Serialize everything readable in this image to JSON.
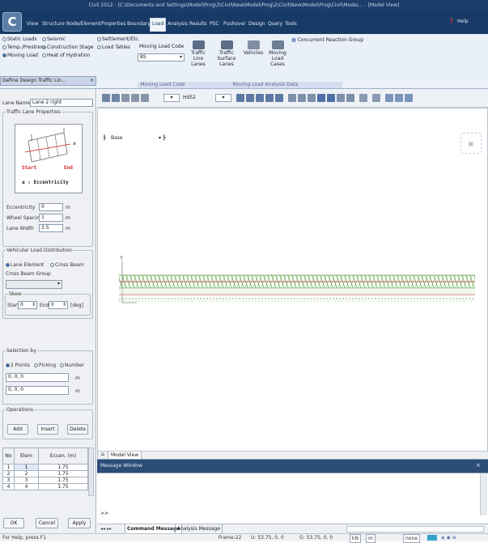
{
  "titlebar": {
    "text": "Civil 2012 - [C:\\Documents and Settings\\Model\\Prog\\2\\Civil\\New\\Model\\Prog\\2\\Civil\\New\\Model\\Prog\\Civil\\Mode\\... - [Model View]"
  },
  "menu": {
    "tabs": [
      "View",
      "Structure",
      "Node/Element",
      "Properties",
      "Boundary",
      "Load",
      "Analysis",
      "Results",
      "PSC",
      "Pushover",
      "Design",
      "Query",
      "Tools"
    ],
    "active": "Load",
    "help": "Help"
  },
  "ribbon": {
    "load_types": [
      "Static Loads",
      "Temp./Prestress",
      "Moving Load"
    ],
    "load_types2": [
      "Seismic",
      "Construction Stage",
      "Heat of Hydration"
    ],
    "settlement": [
      "Settlement/Etc.",
      "Load Tables"
    ],
    "code_label": "Moving Load Code",
    "code_value": "BS",
    "buttons": [
      {
        "l1": "Traffic",
        "l2": "Line Lanes"
      },
      {
        "l1": "Traffic",
        "l2": "Surface Lanes"
      },
      {
        "l1": "Vehicles",
        "l2": ""
      },
      {
        "l1": "Moving",
        "l2": "Load Cases"
      }
    ],
    "concurrent": "Concurrent Reaction Group",
    "group1": "Moving Load Code",
    "group2": "Moving Load Analysis Data"
  },
  "left": {
    "dropdown": "Define Design Traffic Lin...",
    "lane_name_label": "Lane Name :",
    "lane_name_value": "Lane 2 right",
    "props_legend": "Traffic Lane Properties",
    "diagram": {
      "start": "Start",
      "end": "End",
      "eccent": "a : Eccentricity",
      "a": "a"
    },
    "eccentricity_label": "Eccentricity",
    "eccentricity_value": "0",
    "wheel_label": "Wheel Spacing",
    "wheel_value": "1",
    "width_label": "Lane Width",
    "width_value": "3.5",
    "unit": "m",
    "dist_legend": "Vehicular Load Distribution",
    "lane_element": "Lane Element",
    "cross_beam": "Cross Beam",
    "cross_group_label": "Cross Beam Group",
    "skew_legend": "Skew",
    "skew_start": "Start",
    "skew_end": "End",
    "skew_start_val": "0",
    "skew_end_val": "0",
    "skew_unit": "[deg]",
    "selection_legend": "Selection by",
    "sel_opts": [
      "2 Points",
      "Picking",
      "Number"
    ],
    "pt1": "0, 0, 0",
    "pt2": "0, 0, 0",
    "ops_legend": "Operations",
    "ops": [
      "Add",
      "Insert",
      "Delete"
    ],
    "table_head": [
      "No",
      "Elem",
      "Eccen. (m)"
    ],
    "table_rows": [
      [
        "1",
        "1",
        "1.75"
      ],
      [
        "2",
        "2",
        "1.75"
      ],
      [
        "3",
        "3",
        "1.75"
      ],
      [
        "4",
        "4",
        "1.75"
      ]
    ],
    "footer": [
      "OK",
      "Cancel",
      "Apply"
    ]
  },
  "viewport": {
    "base_label": "Base",
    "tab": "Model View",
    "layer": "Hd52"
  },
  "message": {
    "title": "Message Window",
    "tabs": [
      "Command Message",
      "Analysis Message"
    ],
    "prompt": ">>"
  },
  "status": {
    "left": "For Help, press F1",
    "mid1": "Frame-22",
    "mid2": "U: 53.75, 0, 0",
    "mid3": "G: 53.75, 0, 0",
    "unit": "kN",
    "len": "m",
    "none": "none"
  }
}
